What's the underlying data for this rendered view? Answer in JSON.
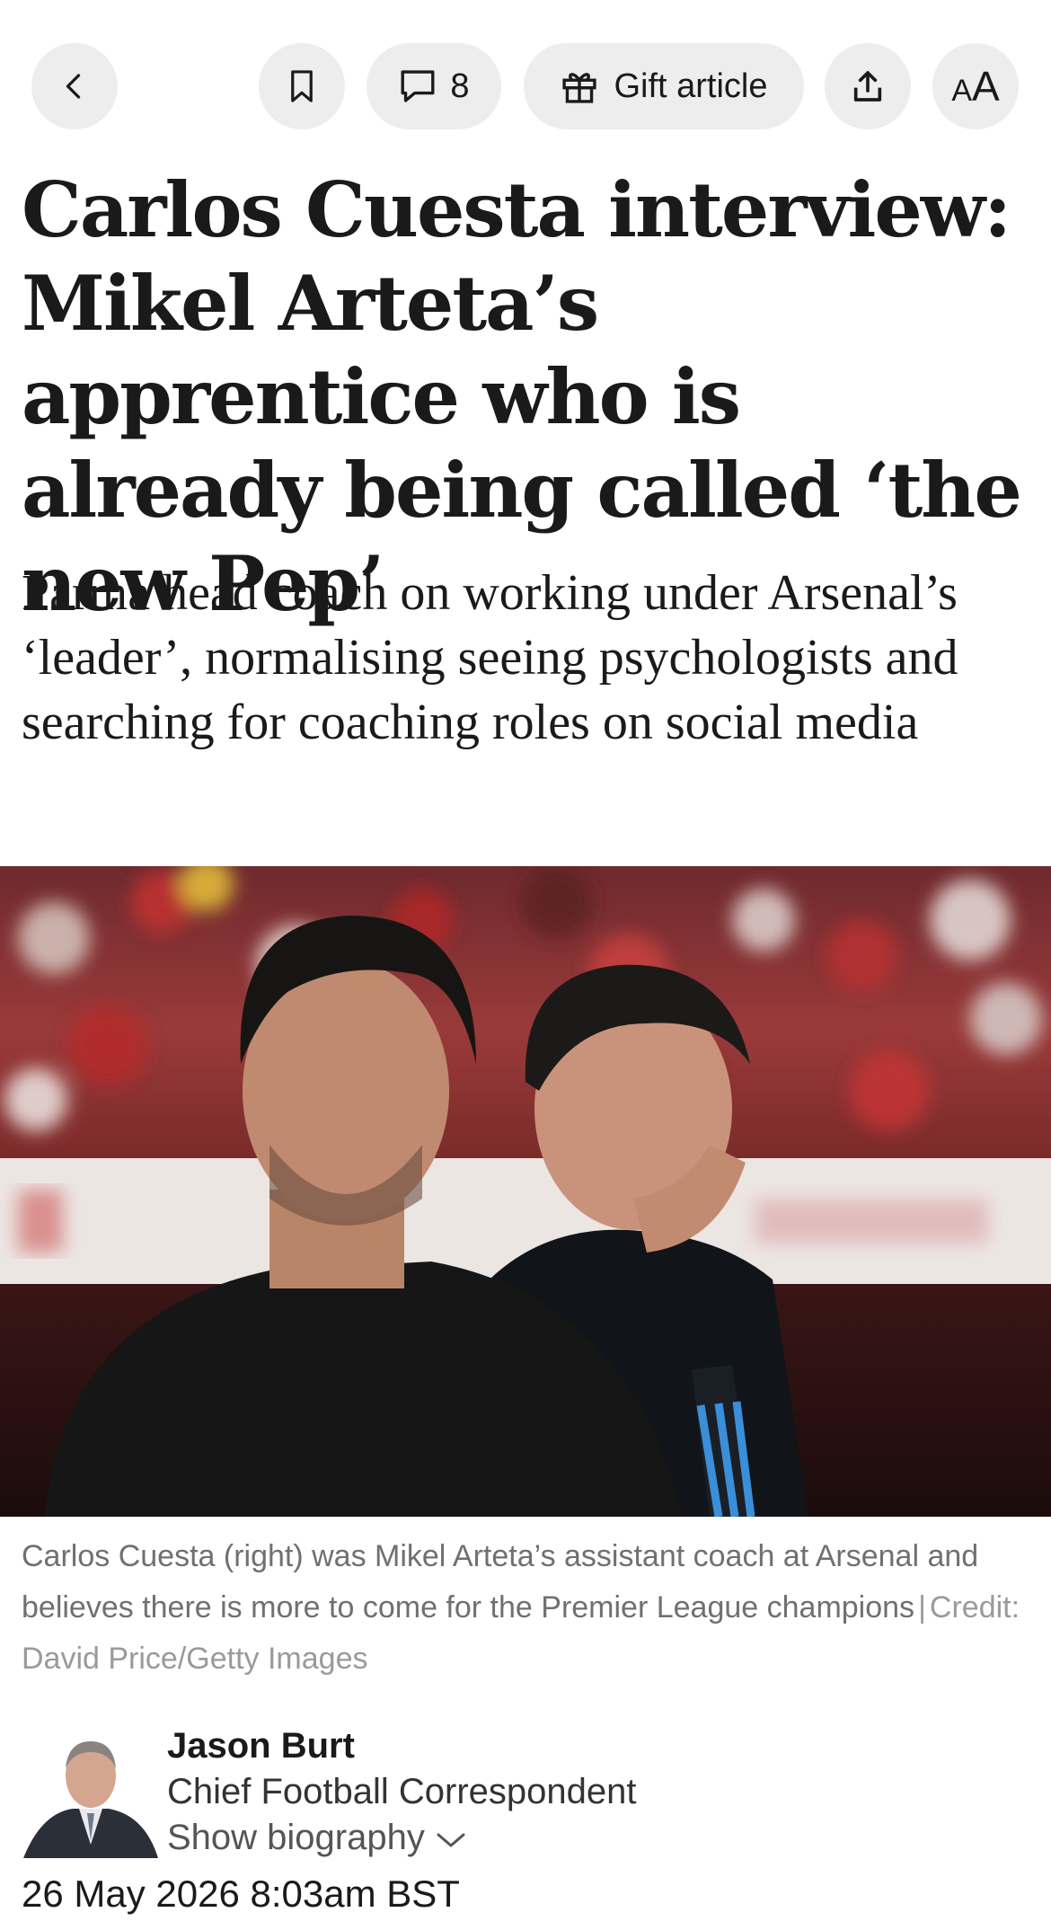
{
  "toolbar": {
    "comment_count": "8",
    "gift_label": "Gift article",
    "font_size_small": "A",
    "font_size_large": "A"
  },
  "article": {
    "headline": "Carlos Cuesta interview: Mikel Arteta’s apprentice who is already being called ‘the new Pep’",
    "standfirst": "Parma head coach on working under Arsenal’s ‘leader’, normalising seeing psychologists and searching for coaching roles on social media",
    "image_caption": "Carlos Cuesta (right) was Mikel Arteta’s assistant coach at Arsenal and believes there is more to come for the Premier League champions",
    "caption_separator": "|",
    "image_credit": "Credit: David Price/Getty Images",
    "author": {
      "name": "Jason Burt",
      "role": "Chief Football Correspondent",
      "bio_toggle": "Show biography"
    },
    "date": "26 May 2026 8:03am BST"
  },
  "colors": {
    "pill_background": "#ededed",
    "text": "#1a1a1a",
    "caption": "#707070"
  },
  "icons": [
    "chevron-left-icon",
    "bookmark-icon",
    "comment-icon",
    "gift-icon",
    "share-icon",
    "chevron-down-icon"
  ]
}
